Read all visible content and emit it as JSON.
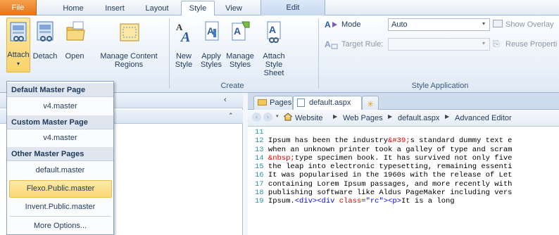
{
  "tabs": [
    {
      "label": "File"
    },
    {
      "label": "Home"
    },
    {
      "label": "Insert"
    },
    {
      "label": "Layout"
    },
    {
      "label": "Style"
    },
    {
      "label": "View"
    },
    {
      "label": "Edit"
    }
  ],
  "ribbon": {
    "attach": {
      "label": "Attach"
    },
    "detach": {
      "label": "Detach"
    },
    "open": {
      "label": "Open"
    },
    "manage_content_regions": {
      "line1": "Manage Content",
      "line2": "Regions"
    },
    "new_style": {
      "line1": "New",
      "line2": "Style"
    },
    "apply_styles": {
      "line1": "Apply",
      "line2": "Styles"
    },
    "manage_styles": {
      "line1": "Manage",
      "line2": "Styles"
    },
    "attach_style_sheet": {
      "line1": "Attach",
      "line2": "Style Sheet"
    },
    "create_group_label": "Create",
    "mode_label": "Mode",
    "mode_value": "Auto",
    "target_rule_label": "Target Rule:",
    "show_overlay": "Show Overlay",
    "reuse_properties": "Reuse Properti",
    "style_application_label": "Style Application"
  },
  "attach_menu": {
    "sections": [
      {
        "header": "Default Master Page",
        "items": [
          "v4.master"
        ]
      },
      {
        "header": "Custom Master Page",
        "items": [
          "v4.master"
        ]
      },
      {
        "header": "Other Master Pages",
        "items": [
          "default.master",
          "Flexo.Public.master",
          "Invent.Public.master"
        ]
      }
    ],
    "more_options": "More Options..."
  },
  "editor": {
    "tabs": [
      {
        "label": "Pages"
      },
      {
        "label": "default.aspx"
      }
    ],
    "breadcrumb": [
      "Website",
      "Web Pages",
      "default.aspx",
      "Advanced Editor"
    ]
  },
  "code_lines": [
    {
      "n": "11",
      "parts": [
        {
          "t": ""
        }
      ]
    },
    {
      "n": "12",
      "parts": [
        {
          "t": "Ipsum has been the industry"
        },
        {
          "t": "&#39;",
          "c": "ent"
        },
        {
          "t": "s standard dummy text e"
        }
      ]
    },
    {
      "n": "13",
      "parts": [
        {
          "t": "when an unknown printer took a galley of type and scram"
        }
      ]
    },
    {
      "n": "14",
      "parts": [
        {
          "t": "&nbsp;",
          "c": "ent"
        },
        {
          "t": "type specimen book. It has survived not only five"
        }
      ]
    },
    {
      "n": "15",
      "parts": [
        {
          "t": "the leap into electronic typesetting, remaining essenti"
        }
      ]
    },
    {
      "n": "16",
      "parts": [
        {
          "t": "It was popularised in the 1960s with the release of Let"
        }
      ]
    },
    {
      "n": "17",
      "parts": [
        {
          "t": "containing Lorem Ipsum passages, and more recently with"
        }
      ]
    },
    {
      "n": "18",
      "parts": [
        {
          "t": "publishing software like Aldus PageMaker including vers"
        }
      ]
    },
    {
      "n": "19",
      "parts": [
        {
          "t": "Ipsum."
        },
        {
          "t": "<div><div ",
          "c": "tag"
        },
        {
          "t": "class",
          "c": "attr"
        },
        {
          "t": "=",
          "c": "tag"
        },
        {
          "t": "\"rc\"",
          "c": "str"
        },
        {
          "t": "><p>",
          "c": "tag"
        },
        {
          "t": "It is a long"
        }
      ]
    }
  ],
  "colors": {
    "accent_file": "#e3731d",
    "highlight": "#fbd775",
    "link_blue": "#0000ff",
    "entity_red": "#e00000"
  }
}
